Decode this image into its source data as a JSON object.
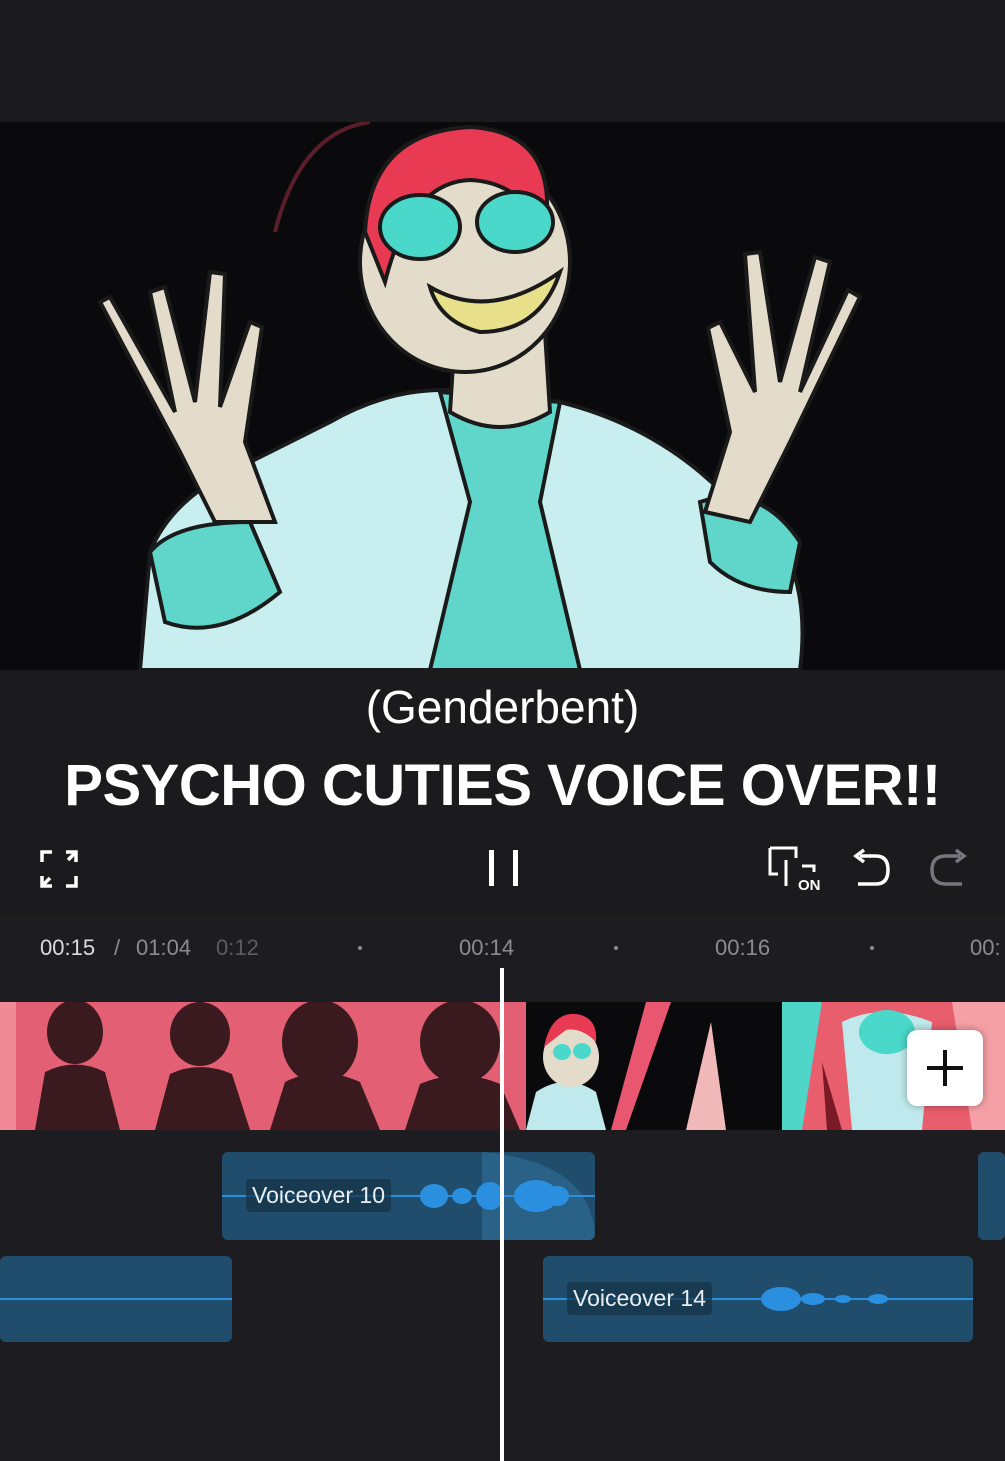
{
  "caption": {
    "subtitle": "(Genderbent)",
    "title": "PSYCHO CUTIES VOICE OVER!!"
  },
  "controls": {
    "fullscreen_icon": "fullscreen-icon",
    "pause_icon": "pause-icon",
    "keyframe_icon": "keyframe-on-icon",
    "keyframe_badge": "ON",
    "undo_icon": "undo-icon",
    "redo_icon": "redo-icon"
  },
  "timeline": {
    "current_time": "00:15",
    "separator": "/",
    "total_time": "01:04",
    "ruler_labels": [
      "0:12",
      "00:14",
      "00:16",
      "00:"
    ]
  },
  "tracks": {
    "add_clip_icon": "plus-icon",
    "audio_clips": [
      {
        "label": "Voiceover 10"
      },
      {
        "label": "Voiceover 14"
      }
    ]
  },
  "colors": {
    "background": "#1b1b1e",
    "audio_clip": "#1f4d6b",
    "waveform": "#2b8fe0",
    "accent_pink": "#e8576f",
    "accent_teal": "#4fd6c8"
  }
}
